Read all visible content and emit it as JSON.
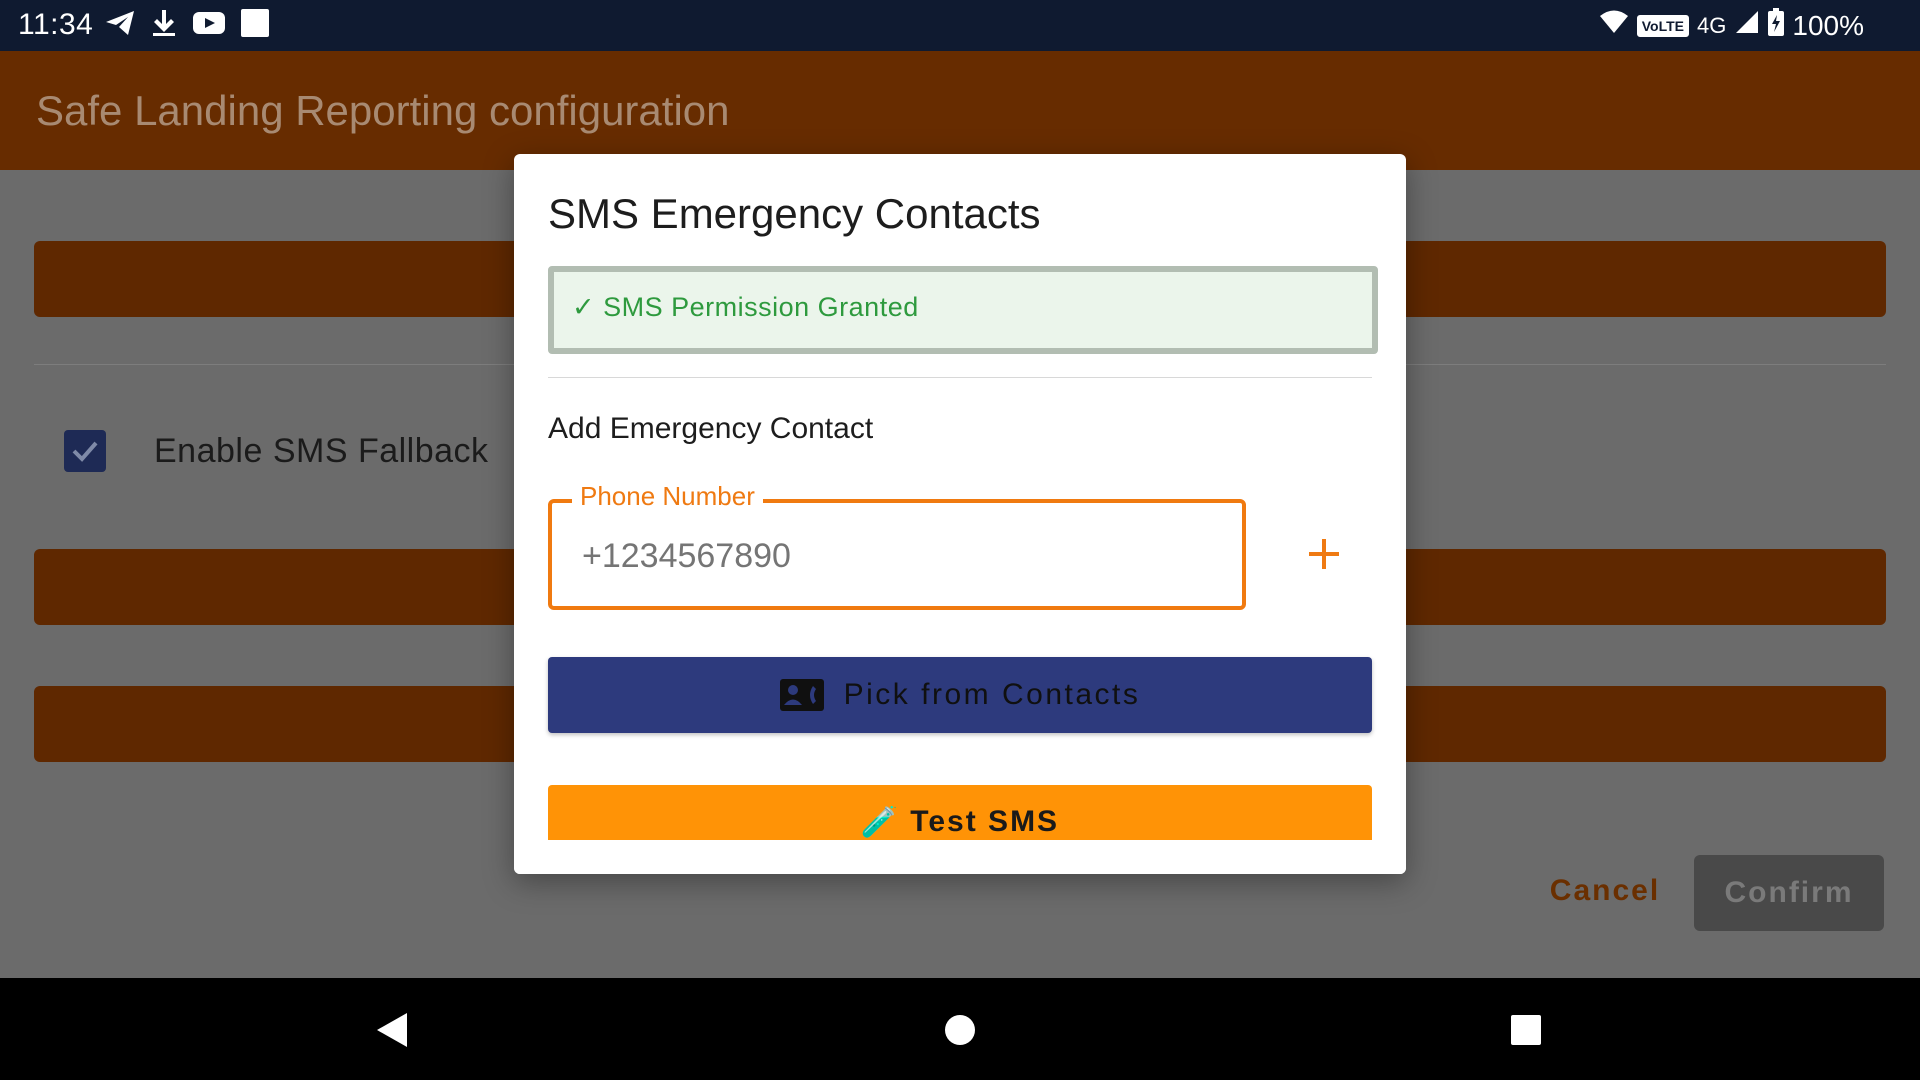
{
  "status_bar": {
    "time": "11:34",
    "left_icons": [
      "telegram-icon",
      "download-icon",
      "youtube-icon",
      "square-notification-icon"
    ],
    "network_badge": "VoLTE",
    "network_type": "4G",
    "battery": "100%"
  },
  "app_bar": {
    "title": "Safe Landing Reporting configuration"
  },
  "background": {
    "sms_fallback_label": "Enable SMS Fallback",
    "sms_fallback_checked": true,
    "cancel_label": "Cancel",
    "confirm_label": "Confirm"
  },
  "dialog": {
    "title": "SMS Emergency Contacts",
    "permission_status": "✓ SMS Permission Granted",
    "section_label": "Add Emergency Contact",
    "phone_field": {
      "label": "Phone Number",
      "placeholder": "+1234567890",
      "value": ""
    },
    "add_icon": "plus-icon",
    "pick_contacts_label": "Pick from Contacts",
    "test_sms_label": "Test SMS",
    "test_sms_icon": "🧪"
  },
  "colors": {
    "accent_orange": "#ff9306",
    "primary_navy": "#2d3a7d",
    "success_green": "#2e9a3e",
    "app_bar_brown": "#672c00"
  },
  "nav_bar": {
    "buttons": [
      "back-icon",
      "home-icon",
      "recents-icon"
    ]
  }
}
